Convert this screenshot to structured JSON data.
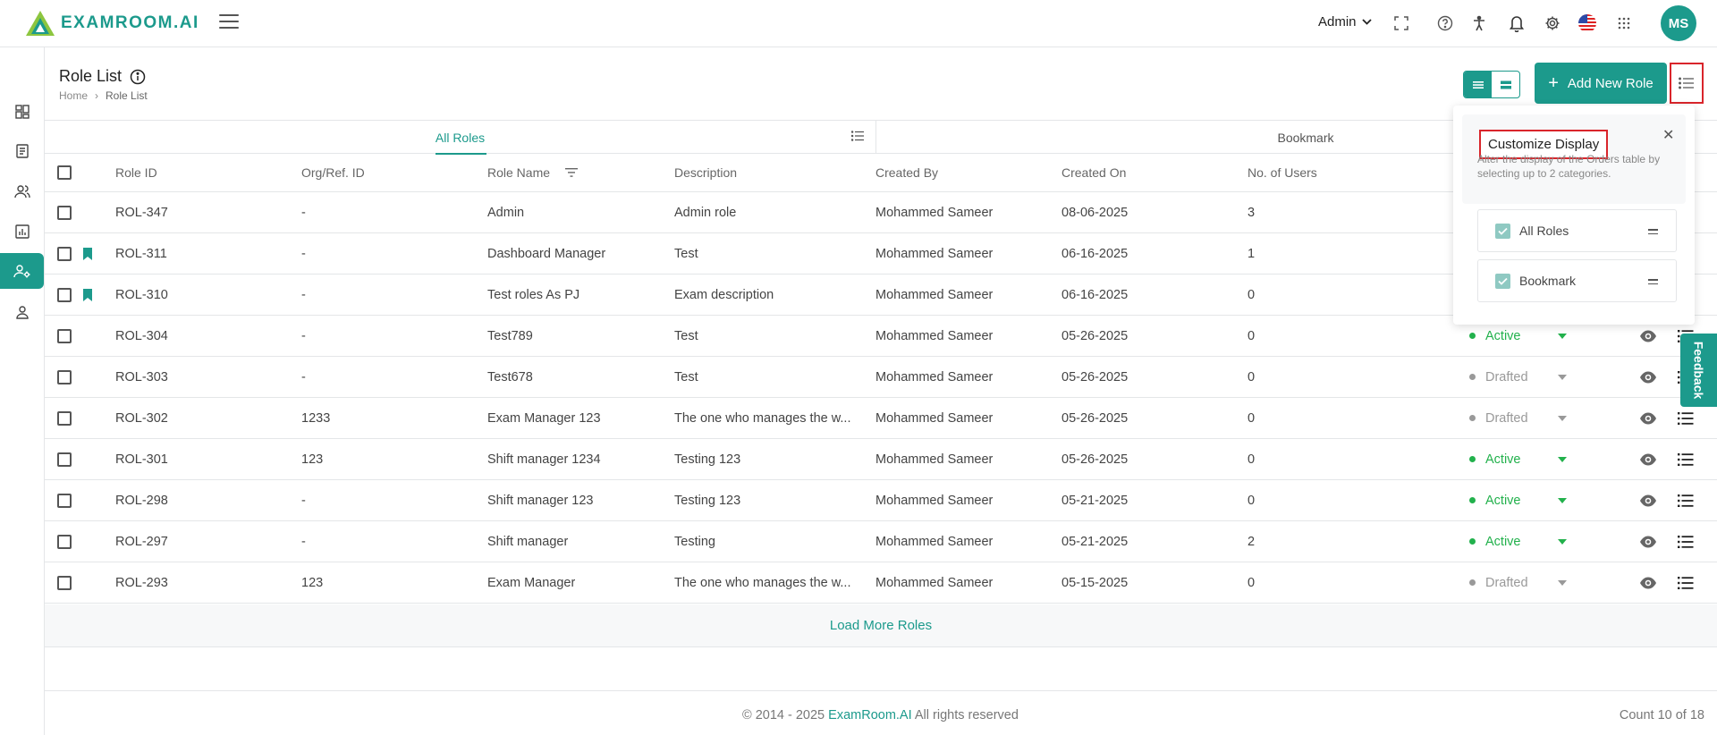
{
  "brand": {
    "name": "EXAMROOM.AI",
    "color": "#1c9a8c"
  },
  "topbar": {
    "role_selector": "Admin",
    "avatar_initials": "MS",
    "icons": [
      "fullscreen-icon",
      "help-icon",
      "accessibility-icon",
      "bell-icon",
      "settings-icon",
      "us-flag-icon",
      "apps-grid-icon"
    ]
  },
  "sidebar": {
    "items": [
      {
        "icon": "dashboard-icon",
        "active": false
      },
      {
        "icon": "document-icon",
        "active": false
      },
      {
        "icon": "users-icon",
        "active": false
      },
      {
        "icon": "report-icon",
        "active": false
      },
      {
        "icon": "role-settings-icon",
        "active": true
      },
      {
        "icon": "user-icon",
        "active": false
      }
    ]
  },
  "page": {
    "title": "Role List",
    "breadcrumb": [
      "Home",
      "Role List"
    ],
    "add_button": "Add New Role"
  },
  "tabs": [
    "All Roles",
    "Bookmark"
  ],
  "table": {
    "headers": [
      "Role ID",
      "Org/Ref. ID",
      "Role Name",
      "Description",
      "Created By",
      "Created On",
      "No. of Users"
    ],
    "rows": [
      {
        "id": "ROL-347",
        "org": "-",
        "name": "Admin",
        "desc": "Admin role",
        "by": "Mohammed Sameer",
        "on": "08-06-2025",
        "users": "3",
        "status": "",
        "bookmarked": false
      },
      {
        "id": "ROL-311",
        "org": "-",
        "name": "Dashboard Manager",
        "desc": "Test",
        "by": "Mohammed Sameer",
        "on": "06-16-2025",
        "users": "1",
        "status": "",
        "bookmarked": true
      },
      {
        "id": "ROL-310",
        "org": "-",
        "name": "Test roles As PJ",
        "desc": "Exam description",
        "by": "Mohammed Sameer",
        "on": "06-16-2025",
        "users": "0",
        "status": "",
        "bookmarked": true
      },
      {
        "id": "ROL-304",
        "org": "-",
        "name": "Test789",
        "desc": "Test",
        "by": "Mohammed Sameer",
        "on": "05-26-2025",
        "users": "0",
        "status": "Active",
        "bookmarked": false
      },
      {
        "id": "ROL-303",
        "org": "-",
        "name": "Test678",
        "desc": "Test",
        "by": "Mohammed Sameer",
        "on": "05-26-2025",
        "users": "0",
        "status": "Drafted",
        "bookmarked": false
      },
      {
        "id": "ROL-302",
        "org": "1233",
        "name": "Exam Manager 123",
        "desc": "The one who manages the w...",
        "by": "Mohammed Sameer",
        "on": "05-26-2025",
        "users": "0",
        "status": "Drafted",
        "bookmarked": false
      },
      {
        "id": "ROL-301",
        "org": "123",
        "name": "Shift manager 1234",
        "desc": "Testing 123",
        "by": "Mohammed Sameer",
        "on": "05-26-2025",
        "users": "0",
        "status": "Active",
        "bookmarked": false
      },
      {
        "id": "ROL-298",
        "org": "-",
        "name": "Shift manager 123",
        "desc": "Testing 123",
        "by": "Mohammed Sameer",
        "on": "05-21-2025",
        "users": "0",
        "status": "Active",
        "bookmarked": false
      },
      {
        "id": "ROL-297",
        "org": "-",
        "name": "Shift manager",
        "desc": "Testing",
        "by": "Mohammed Sameer",
        "on": "05-21-2025",
        "users": "2",
        "status": "Active",
        "bookmarked": false
      },
      {
        "id": "ROL-293",
        "org": "123",
        "name": "Exam Manager",
        "desc": "The one who manages the w...",
        "by": "Mohammed Sameer",
        "on": "05-15-2025",
        "users": "0",
        "status": "Drafted",
        "bookmarked": false
      }
    ],
    "load_more": "Load More Roles"
  },
  "footer": {
    "copyright_prefix": "© 2014 - 2025",
    "copyright_brand": "ExamRoom.AI",
    "copyright_suffix": "All rights reserved",
    "count": "Count 10 of 18"
  },
  "customize_panel": {
    "title": "Customize Display",
    "description": "Alter the display of the Orders table by selecting up to 2 categories.",
    "items": [
      {
        "label": "All Roles",
        "checked": true
      },
      {
        "label": "Bookmark",
        "checked": true
      }
    ]
  },
  "feedback": "Feedback",
  "colors": {
    "active": "#22b14c",
    "drafted": "#999999",
    "highlight": "#d9252b"
  }
}
